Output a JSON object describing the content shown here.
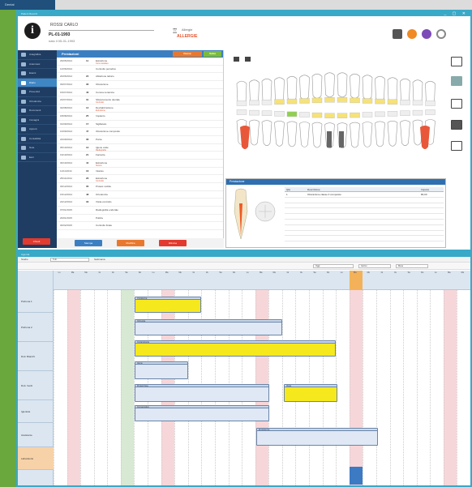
{
  "top": {
    "tab_label": "Dental"
  },
  "window1": {
    "title": "Patient Record",
    "controls": "_ ▢ ✕",
    "patient": {
      "name": "ROSSI CARLO",
      "id": "PL-01-1993",
      "dob": "nato il 05-01-1993",
      "allergy_label": "Allergie",
      "alert": "ALLERGIE"
    },
    "header_icons": [
      {
        "name": "print-icon",
        "color": "#555555"
      },
      {
        "name": "circle-orange-icon",
        "color": "#f08a24"
      },
      {
        "name": "circle-purple-icon",
        "color": "#7c4bb8"
      },
      {
        "name": "circle-outline-icon",
        "color": "#888888"
      }
    ],
    "sidebar": [
      {
        "label": "Anagrafica"
      },
      {
        "label": "Anamnesi"
      },
      {
        "label": "Esami"
      },
      {
        "label": "Diario"
      },
      {
        "label": "Preventivi"
      },
      {
        "label": "Ortodonzia"
      },
      {
        "label": "Documenti"
      },
      {
        "label": "Immagini"
      },
      {
        "label": "Appunt."
      },
      {
        "label": "Contabilità"
      },
      {
        "label": "Note"
      },
      {
        "label": "Esci"
      }
    ],
    "sidebar_button": "Chiudi",
    "list": {
      "title": "Prestazioni",
      "btn1": "Nuova",
      "btn2": "Salva",
      "rows": [
        {
          "date": "29/05/2014",
          "tooth": "11",
          "text": "Estrazione",
          "note": "Cura canalare"
        },
        {
          "date": "12/06/2014",
          "tooth": "",
          "text": "Controllo periodico",
          "note": ""
        },
        {
          "date": "20/06/2014",
          "tooth": "24",
          "text": "Ablazione tartaro",
          "note": ""
        },
        {
          "date": "03/07/2014",
          "tooth": "36",
          "text": "Otturazione",
          "note": ""
        },
        {
          "date": "15/07/2014",
          "tooth": "46",
          "text": "Corona ceramica",
          "note": ""
        },
        {
          "date": "22/07/2014",
          "tooth": "31",
          "text": "Sbiancamento dentale",
          "note": "Controllo"
        },
        {
          "date": "02/08/2014",
          "tooth": "14",
          "text": "Devitalizzazione",
          "note": "Estrazione"
        },
        {
          "date": "18/08/2014",
          "tooth": "25",
          "text": "Impianto",
          "note": ""
        },
        {
          "date": "01/09/2014",
          "tooth": "17",
          "text": "Sigillatura",
          "note": ""
        },
        {
          "date": "10/09/2014",
          "tooth": "47",
          "text": "Otturazione composito",
          "note": ""
        },
        {
          "date": "24/09/2014",
          "tooth": "36",
          "text": "Ponte",
          "note": ""
        },
        {
          "date": "05/10/2014",
          "tooth": "12",
          "text": "Igiene orale",
          "note": "Radiografia"
        },
        {
          "date": "19/10/2014",
          "tooth": "21",
          "text": "Faccette",
          "note": ""
        },
        {
          "date": "30/10/2014",
          "tooth": "44",
          "text": "Estrazione",
          "note": "Sutura"
        },
        {
          "date": "11/11/2014",
          "tooth": "16",
          "text": "Intarsio",
          "note": ""
        },
        {
          "date": "25/11/2014",
          "tooth": "26",
          "text": "Estrazione",
          "note": "Controllo"
        },
        {
          "date": "03/12/2014",
          "tooth": "35",
          "text": "Protesi mobile",
          "note": ""
        },
        {
          "date": "15/12/2014",
          "tooth": "48",
          "text": "Ortodonzia",
          "note": ""
        },
        {
          "date": "22/12/2014",
          "tooth": "33",
          "text": "Visita controllo",
          "note": ""
        },
        {
          "date": "07/01/2015",
          "tooth": "",
          "text": "Radiografia endorale",
          "note": ""
        },
        {
          "date": "20/01/2015",
          "tooth": "",
          "text": "Pulizia",
          "note": ""
        },
        {
          "date": "04/02/2015",
          "tooth": "",
          "text": "Controllo finale",
          "note": ""
        }
      ]
    },
    "footer_buttons": [
      {
        "label": "Stampa",
        "color": "#3c7fc1"
      },
      {
        "label": "Modifica",
        "color": "#e8782f"
      },
      {
        "label": "Elimina",
        "color": "#e23a2e"
      }
    ],
    "detail": {
      "title": "Prestazione",
      "cols": [
        "Qtà",
        "Descrizione",
        "Importo"
      ],
      "rows": [
        {
          "q": "1",
          "desc": "Otturazione classe II composito",
          "amount": "80,00"
        }
      ]
    }
  },
  "window2": {
    "title": "Agenda",
    "filter_label": "Studio",
    "filter_value": "Tutti",
    "filter2": "Settimana",
    "nav_labels": [
      "Oggi",
      "Giorno",
      "Mese"
    ],
    "days": [
      "Lu",
      "Ma",
      "Me",
      "Gi",
      "Ve",
      "Sa",
      "Do",
      "Lu",
      "Ma",
      "Me",
      "Gi",
      "Ve",
      "Sa",
      "Do",
      "Lu",
      "Ma",
      "Me",
      "Gi",
      "Ve",
      "Sa",
      "Do",
      "Lu",
      "Ma",
      "Me",
      "Gi",
      "Ve",
      "Sa",
      "Do",
      "Lu",
      "Ma",
      "Me"
    ],
    "resources": [
      {
        "label": "Poltrona 1",
        "highlight": false
      },
      {
        "label": "Poltrona 2",
        "highlight": false
      },
      {
        "label": "Dott. Bianchi",
        "highlight": false
      },
      {
        "label": "Dott. Verdi",
        "highlight": false
      },
      {
        "label": "Igienista",
        "highlight": false
      },
      {
        "label": "Assistente",
        "highlight": false
      },
      {
        "label": "Laboratorio",
        "highlight": true
      }
    ],
    "bars": [
      {
        "label": "Ortodonzia",
        "color": "yellow"
      },
      {
        "label": "Chirurgia",
        "color": "blue"
      },
      {
        "label": "Implantologia",
        "color": "yellow"
      },
      {
        "label": "Igiene",
        "color": "blue"
      },
      {
        "label": "Protesi fissa",
        "color": "blue"
      },
      {
        "label": "Visita",
        "color": "yellow"
      },
      {
        "label": "Conservativa",
        "color": "blue"
      },
      {
        "label": "Endodonzia",
        "color": "blue"
      }
    ]
  }
}
